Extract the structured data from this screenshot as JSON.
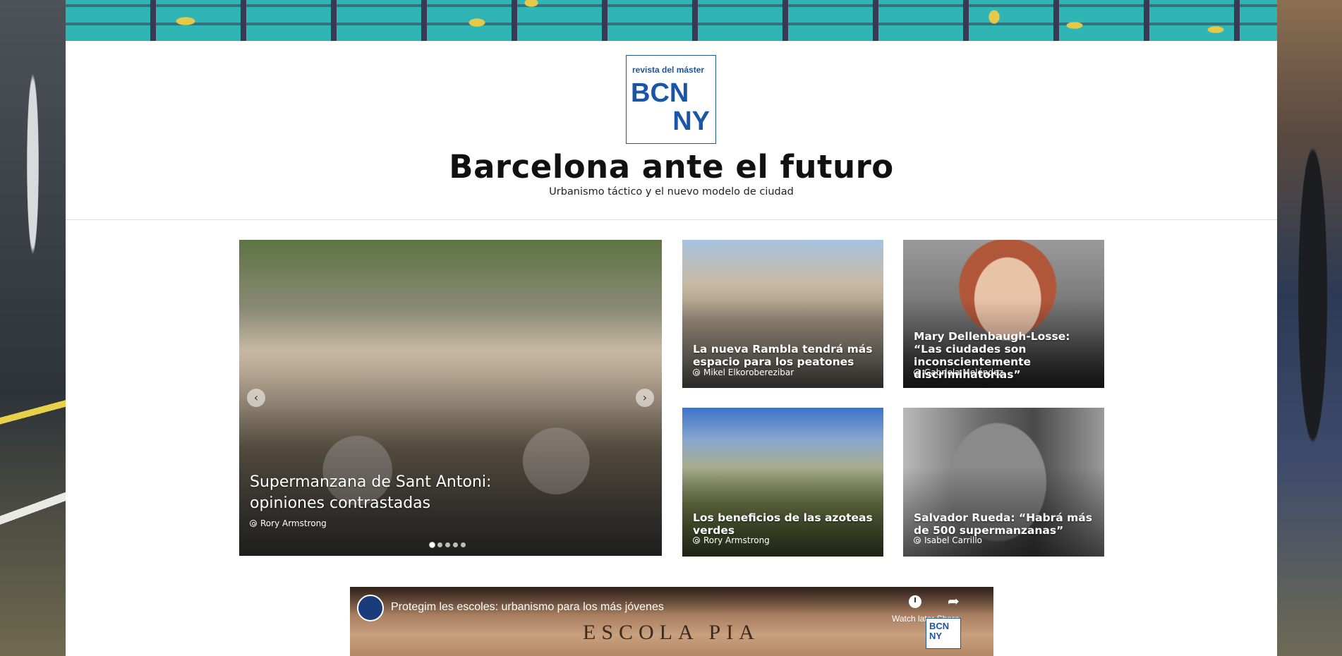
{
  "header": {
    "logo_top": "revista del máster",
    "logo_line1": "BCN",
    "logo_line2": "NY",
    "title": "Barcelona ante el futuro",
    "subtitle": "Urbanismo táctico y el nuevo modelo de ciudad"
  },
  "featured": {
    "title": "Supermanzana de Sant Antoni: opiniones contrastadas",
    "author": "Rory Armstrong",
    "slides": 5,
    "active_slide": 1
  },
  "cards": [
    {
      "title": "La nueva Rambla tendrá más espacio para los peatones",
      "author": "Mikel Elkoroberezibar"
    },
    {
      "title": "Mary Dellenbaugh-Losse: “Las ciudades son inconscientemente discriminatorias”",
      "author": "Gabriela Meléndez"
    },
    {
      "title": "Los beneficios de las azoteas verdes",
      "author": "Rory Armstrong"
    },
    {
      "title": "Salvador Rueda: “Habrá más de 500 supermanzanas”",
      "author": "Isabel Carrillo"
    }
  ],
  "video": {
    "title": "Protegim les escoles: urbanismo para los más jóvenes",
    "watch_label": "Watch later",
    "share_label": "Share",
    "sign_text": "ESCOLA PIA",
    "mini_logo": "BCN NY"
  },
  "icons": {
    "prev": "chevron-left-icon",
    "next": "chevron-right-icon",
    "author": "user-circle-icon",
    "watch_later": "clock-icon",
    "share": "share-icon"
  }
}
